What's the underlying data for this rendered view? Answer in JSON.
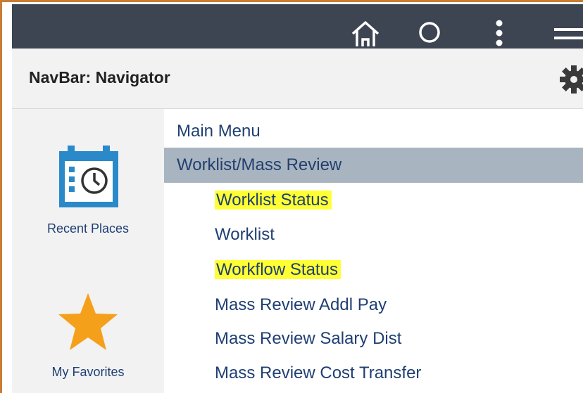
{
  "topbar": {
    "icons": [
      "home-icon",
      "search-icon",
      "more-vertical-icon",
      "hamburger-menu-icon"
    ]
  },
  "header": {
    "title": "NavBar: Navigator",
    "settings_icon": "gear-icon"
  },
  "sidebar": {
    "tiles": [
      {
        "label": "Recent Places",
        "icon": "calendar-clock-icon"
      },
      {
        "label": "My Favorites",
        "icon": "star-icon"
      }
    ]
  },
  "menu": {
    "items": [
      {
        "label": "Main Menu",
        "level": 0
      },
      {
        "label": "Worklist/Mass Review",
        "level": 0,
        "selected": true
      },
      {
        "label": "Worklist Status",
        "level": 1,
        "highlighted": true
      },
      {
        "label": "Worklist",
        "level": 1
      },
      {
        "label": "Workflow Status",
        "level": 1,
        "highlighted": true
      },
      {
        "label": "Mass Review Addl Pay",
        "level": 1
      },
      {
        "label": "Mass Review Salary Dist",
        "level": 1
      },
      {
        "label": "Mass Review Cost Transfer",
        "level": 1
      }
    ]
  },
  "colors": {
    "topbar": "#3e4552",
    "header": "#f2f2f2",
    "selected_row": "#a8b4c0",
    "highlight": "#ffff33",
    "link_text": "#1f3f73",
    "star": "#f5a01a",
    "calendar": "#2a8ac9",
    "frame_border": "#c97d34"
  }
}
